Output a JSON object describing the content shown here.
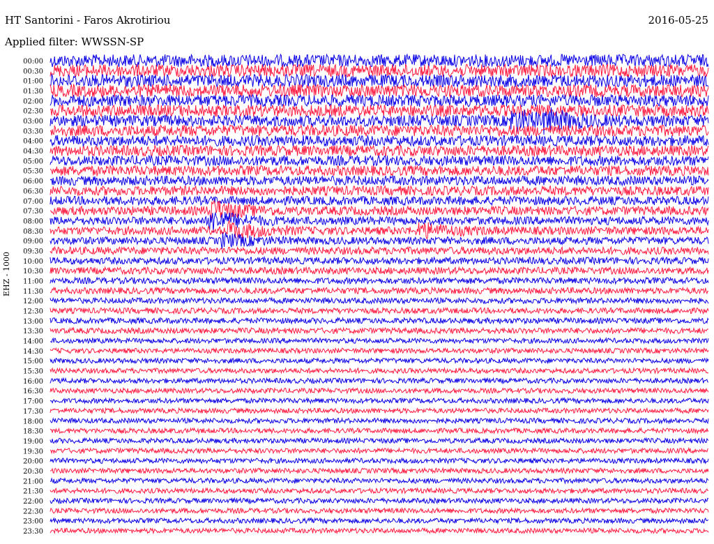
{
  "header": {
    "station": "HT Santorini - Faros Akrotiriou",
    "date": "2016-05-25",
    "filter": "Applied filter: WWSSN-SP"
  },
  "channel_label": "EHZ - 1000",
  "colors": {
    "trace_even": "#0a00e6",
    "trace_odd": "#ff1a40",
    "background": "#ffffff",
    "text": "#000000"
  },
  "chart_data": {
    "type": "line",
    "title": "HT Santorini - Faros Akrotiriou",
    "subtitle": "Applied filter: WWSSN-SP",
    "ylabel": "EHZ - 1000",
    "y_tick_labels": [
      "00:00",
      "00:30",
      "01:00",
      "01:30",
      "02:00",
      "02:30",
      "03:00",
      "03:30",
      "04:00",
      "04:30",
      "05:00",
      "05:30",
      "06:00",
      "06:30",
      "07:00",
      "07:30",
      "08:00",
      "08:30",
      "09:00",
      "09:30",
      "10:00",
      "10:30",
      "11:00",
      "11:30",
      "12:00",
      "12:30",
      "13:00",
      "13:30",
      "14:00",
      "14:30",
      "15:00",
      "15:30",
      "16:00",
      "16:30",
      "17:00",
      "17:30",
      "18:00",
      "18:30",
      "19:00",
      "19:30",
      "20:00",
      "20:30",
      "21:00",
      "21:30",
      "22:00",
      "22:30",
      "23:00",
      "23:30"
    ],
    "series_colors": [
      "blue",
      "red"
    ],
    "noise_amplitude_profile": [
      1.0,
      1.0,
      1.0,
      1.0,
      0.95,
      0.95,
      0.9,
      0.9,
      0.85,
      0.85,
      0.8,
      0.8,
      0.75,
      0.75,
      0.7,
      0.7,
      0.65,
      0.65,
      0.6,
      0.6,
      0.55,
      0.55,
      0.5,
      0.5,
      0.45,
      0.45,
      0.45,
      0.45,
      0.4,
      0.4,
      0.4,
      0.4,
      0.4,
      0.4,
      0.4,
      0.4,
      0.4,
      0.4,
      0.4,
      0.4,
      0.4,
      0.4,
      0.4,
      0.4,
      0.4,
      0.4,
      0.4,
      0.4
    ],
    "events": [
      {
        "row": 6,
        "position": 0.7,
        "strength": 1.6
      },
      {
        "row": 6,
        "position": 0.75,
        "strength": 1.4
      },
      {
        "row": 15,
        "position": 0.24,
        "strength": 2.2
      },
      {
        "row": 16,
        "position": 0.24,
        "strength": 2.6
      },
      {
        "row": 17,
        "position": 0.27,
        "strength": 2.0
      },
      {
        "row": 17,
        "position": 0.56,
        "strength": 1.6
      },
      {
        "row": 18,
        "position": 0.26,
        "strength": 1.5
      }
    ]
  }
}
